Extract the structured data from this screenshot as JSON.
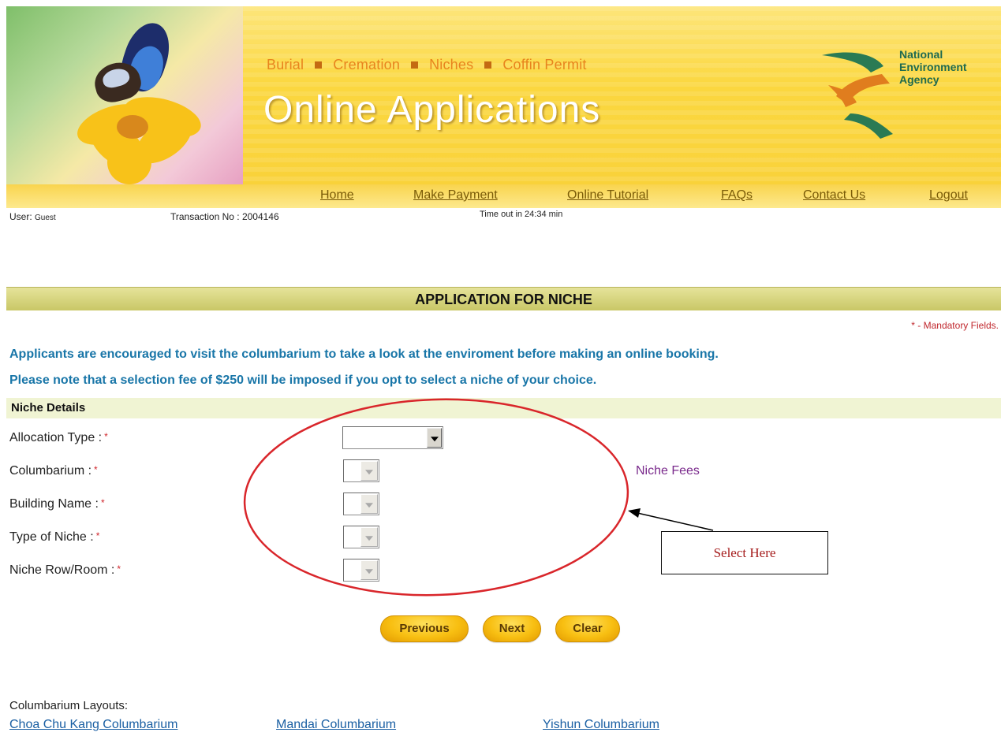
{
  "banner": {
    "links": [
      "Burial",
      "Cremation",
      "Niches",
      "Coffin Permit"
    ],
    "title": "Online Applications",
    "agency": [
      "National",
      "Environment",
      "Agency"
    ]
  },
  "nav": {
    "items": [
      "Home",
      "Make Payment",
      "Online Tutorial",
      "FAQs",
      "Contact Us",
      "Logout"
    ]
  },
  "status": {
    "user_label": "User:",
    "user_value": "Guest",
    "transaction_label": "Transaction No :",
    "transaction_value": "2004146",
    "timeout": "Time out in 24:34 min"
  },
  "form": {
    "title": "APPLICATION FOR NICHE",
    "mandatory_note": "* - Mandatory Fields.",
    "notice1": "Applicants are encouraged to visit the columbarium to take a look at the enviroment before making an online booking.",
    "notice2": "Please note that a selection fee of $250 will be imposed if you opt to select a niche of your choice.",
    "section_title": "Niche Details",
    "fields": [
      {
        "label": "Allocation Type :",
        "value": ""
      },
      {
        "label": "Columbarium :",
        "value": ""
      },
      {
        "label": "Building Name :",
        "value": ""
      },
      {
        "label": "Type of Niche :",
        "value": ""
      },
      {
        "label": "Niche Row/Room :",
        "value": ""
      }
    ],
    "required_marker": "*",
    "niche_fees_link": "Niche Fees",
    "annotation": "Select Here",
    "buttons": {
      "previous": "Previous",
      "next": "Next",
      "clear": "Clear"
    }
  },
  "layouts": {
    "label": "Columbarium Layouts:",
    "links": [
      "Choa Chu Kang Columbarium",
      "Mandai Columbarium",
      "Yishun Columbarium"
    ]
  },
  "colors": {
    "banner_yellow": "#fbd73f",
    "notice_blue": "#1976a8",
    "required_red": "#d0262c",
    "annotation_red": "#d9262b",
    "link_purple": "#7a2a8c",
    "button_gold": "#f8bf12"
  },
  "icons": [
    "butterfly-on-flower-photo",
    "nea-logo",
    "dropdown-arrow-icon",
    "annotation-arrow"
  ]
}
